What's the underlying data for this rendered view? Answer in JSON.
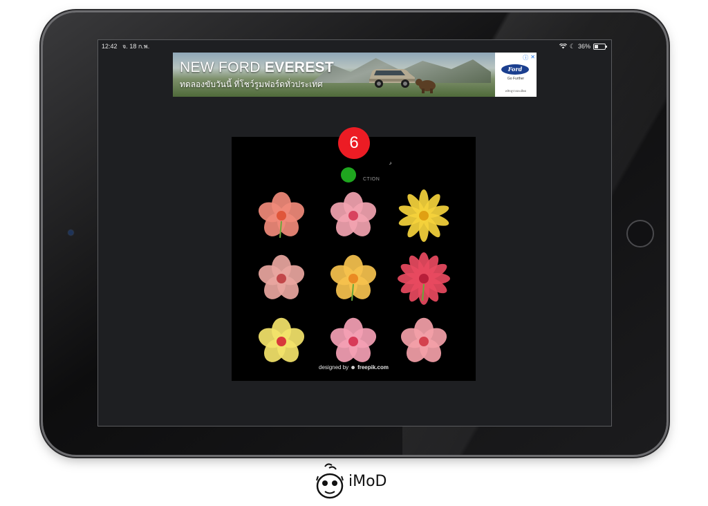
{
  "status_bar": {
    "time": "12:42",
    "date": "จ. 18 ก.พ.",
    "battery_percent_label": "36%",
    "battery_level": 0.36,
    "wifi_icon": "wifi-icon",
    "moon_icon": "do-not-disturb-icon"
  },
  "ad": {
    "headline_regular": "NEW FORD ",
    "headline_bold": "EVEREST",
    "subline": "ทดลองขับวันนี้ ที่โชว์รูมฟอร์ดทั่วประเทศ",
    "brand": "Ford",
    "tagline": "Go Further",
    "small_print": "คลิกดูรายละเอียด",
    "info_icon": "ⓘ",
    "close_icon": "✕"
  },
  "game": {
    "counter": "6",
    "top_text": "CTION",
    "watermark_prefix": "designed by",
    "watermark_brand": "freepik.com",
    "flowers": [
      {
        "name": "pink-orange-flower",
        "petal": "#f08a7a",
        "center": "#e0563a"
      },
      {
        "name": "pink-blossom",
        "petal": "#f2a3b0",
        "center": "#d8435e"
      },
      {
        "name": "yellow-daisy",
        "petal": "#f5d33c",
        "center": "#e0a012"
      },
      {
        "name": "dark-pink-flower",
        "petal": "#e9a6a0",
        "center": "#c2474a"
      },
      {
        "name": "yellow-orange-flower",
        "petal": "#f6c24e",
        "center": "#ea8a23"
      },
      {
        "name": "red-dahlia",
        "petal": "#e84a5f",
        "center": "#b81e3a"
      },
      {
        "name": "yellow-red-flower",
        "petal": "#f3e36a",
        "center": "#d8393a"
      },
      {
        "name": "pink-lily",
        "petal": "#f4a0b4",
        "center": "#d83a58"
      },
      {
        "name": "peach-blossom",
        "petal": "#f3a0a8",
        "center": "#d4414e"
      }
    ]
  },
  "logo": {
    "text": "iMoD"
  }
}
